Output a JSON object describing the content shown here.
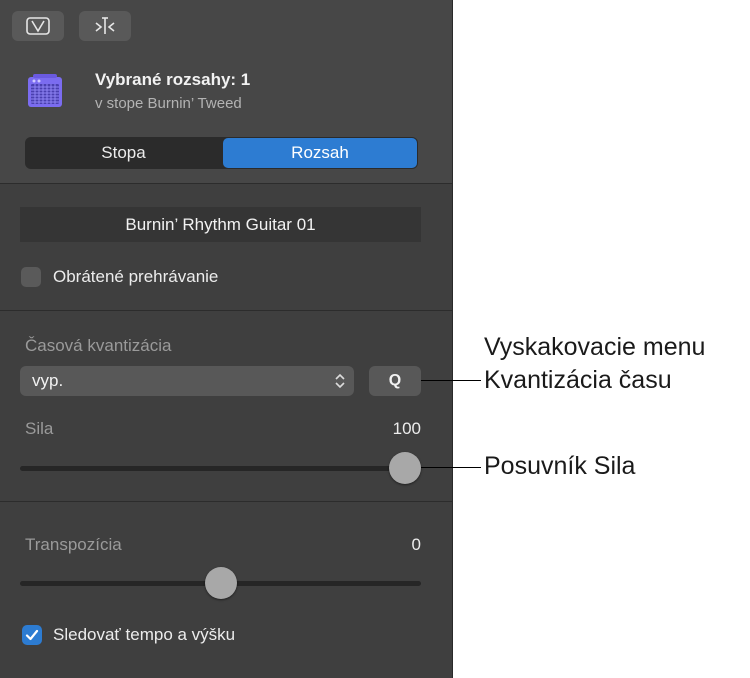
{
  "inspector": {
    "header": {
      "title": "Vybrané rozsahy: 1",
      "subtitle": "v stope Burnin’ Tweed"
    },
    "tabs": [
      {
        "label": "Stopa",
        "selected": false
      },
      {
        "label": "Rozsah",
        "selected": true
      }
    ],
    "region_name": "Burnin’ Rhythm Guitar 01",
    "reverse_playback": {
      "label": "Obrátené prehrávanie",
      "checked": false
    },
    "time_quantize": {
      "label": "Časová kvantizácia",
      "selected_value": "vyp.",
      "q_button_label": "Q"
    },
    "strength": {
      "label": "Sila",
      "value": "100",
      "level_percent": 100
    },
    "transpose": {
      "label": "Transpozícia",
      "value": "0",
      "level_percent": 50
    },
    "follow_tempo": {
      "label": "Sledovať tempo a výšku",
      "checked": true
    }
  },
  "callouts": {
    "quantize_line1": "Vyskakovacie menu",
    "quantize_line2": "Kvantizácia času",
    "strength": "Posuvník Sila"
  },
  "colors": {
    "accent": "#2d7cd2",
    "panel_bg": "#3f3f3f",
    "icon_purple": "#7b6cf0"
  }
}
